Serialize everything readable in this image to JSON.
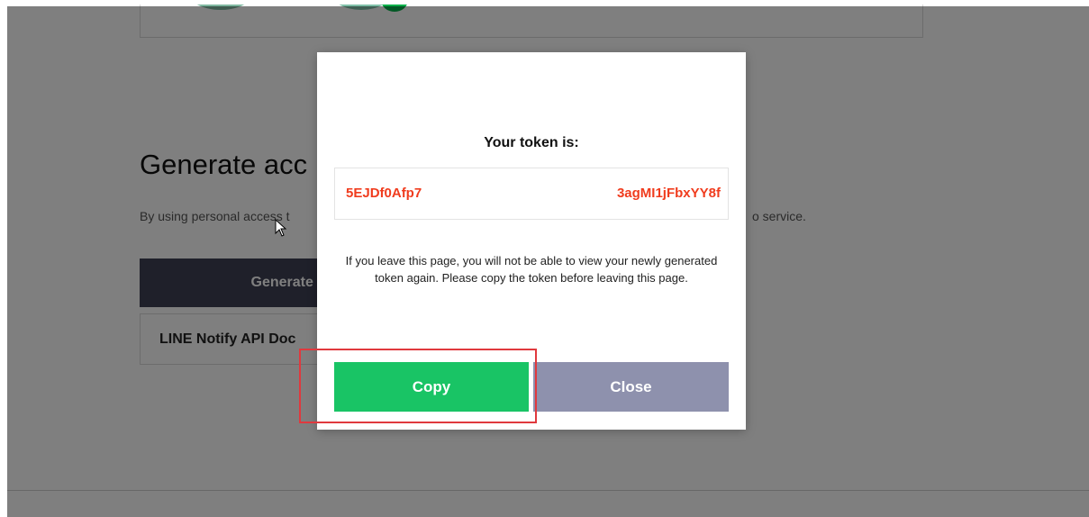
{
  "page": {
    "section_title": "Generate acc",
    "section_desc_left": "By using personal access t",
    "section_desc_right": "o service.",
    "generate_button": "Generate toker",
    "docs_button": "LINE Notify API Doc"
  },
  "modal": {
    "title": "Your token is:",
    "token_left": "5EJDf0Afp7",
    "token_right": "3agMI1jFbxYY8f",
    "message": "If you leave this page, you will not be able to view your newly generated token again. Please copy the token before leaving this page.",
    "copy_label": "Copy",
    "close_label": "Close"
  },
  "colors": {
    "accent_green": "#19c465",
    "close_button": "#8e91ad",
    "token_text": "#f03c1e",
    "highlight_box": "#e0393e"
  }
}
